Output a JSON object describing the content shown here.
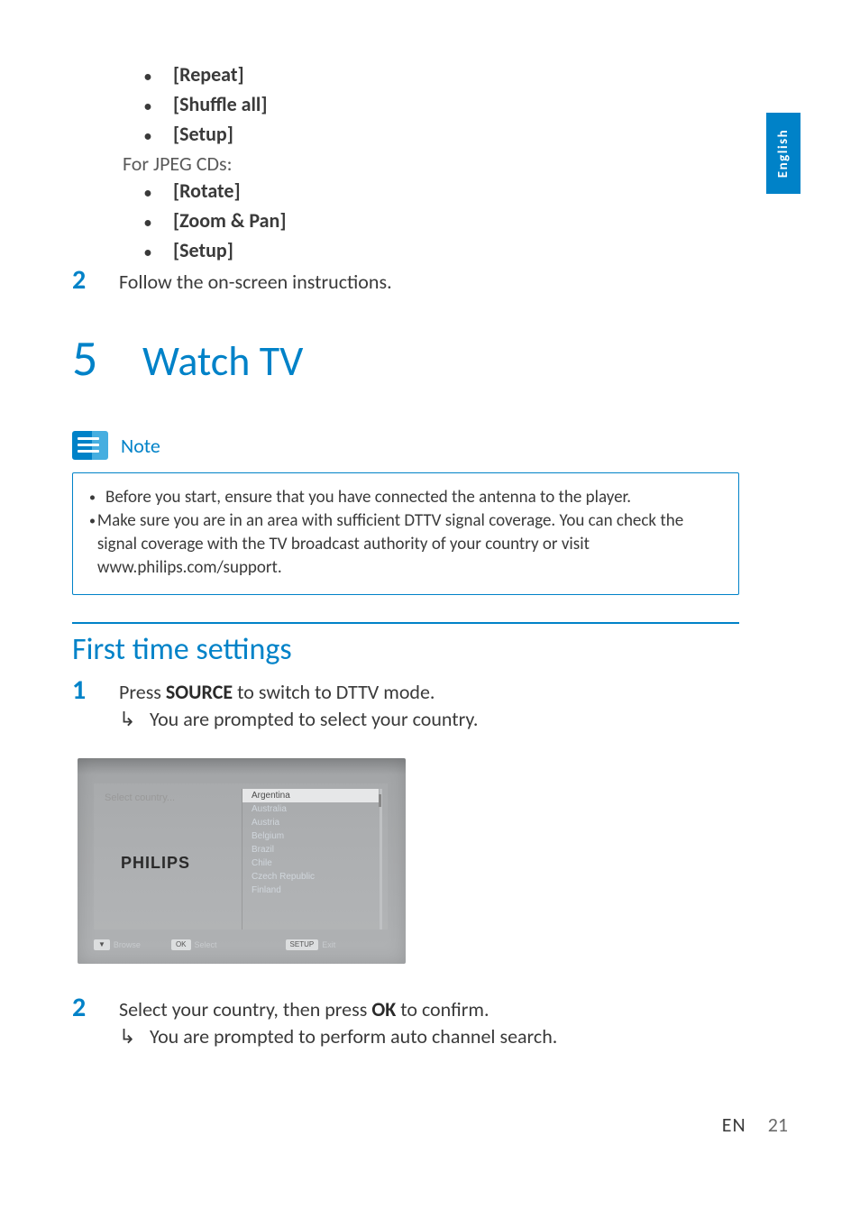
{
  "lang_tab": "English",
  "top_bullets_a": [
    "[Repeat]",
    "[Shuffle all]",
    "[Setup]"
  ],
  "subnote": "For JPEG CDs:",
  "top_bullets_b": [
    "[Rotate]",
    "[Zoom & Pan]",
    "[Setup]"
  ],
  "step_top": {
    "num": "2",
    "text": "Follow the on-screen instructions."
  },
  "chapter": {
    "num": "5",
    "title": "Watch TV"
  },
  "note": {
    "label": "Note",
    "items": [
      "Before you start, ensure that you have connected the antenna to the player.",
      "Make sure you are in an area with sufficient DTTV signal coverage. You can check the signal coverage with the TV broadcast authority of your country or visit www.philips.com/support."
    ]
  },
  "section_title": "First time settings",
  "step1": {
    "num": "1",
    "pre": "Press ",
    "strong": "SOURCE",
    "post": " to switch to DTTV mode.",
    "result": "You are prompted to select your country."
  },
  "screenshot": {
    "label": "Select country...",
    "brand": "PHILIPS",
    "countries": [
      "Argentina",
      "Australia",
      "Austria",
      "Belgium",
      "Brazil",
      "Chile",
      "Czech Republic",
      "Finland"
    ],
    "footer": {
      "browse_btn": "▼",
      "browse": "Browse",
      "select_btn": "OK",
      "select": "Select",
      "exit_btn": "SETUP",
      "exit": "Exit"
    }
  },
  "step2": {
    "num": "2",
    "pre": "Select your country, then press ",
    "strong": "OK",
    "post": " to confirm.",
    "result": "You are prompted to perform auto channel search."
  },
  "footer": {
    "lang": "EN",
    "page": "21"
  }
}
